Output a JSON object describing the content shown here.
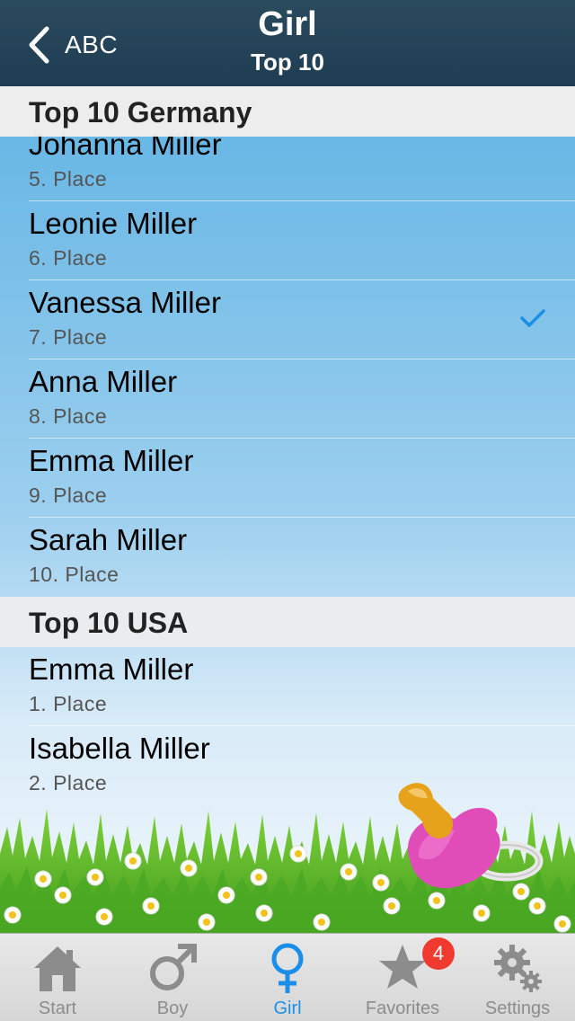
{
  "navbar": {
    "back_label": "ABC",
    "title": "Girl",
    "subtitle": "Top 10"
  },
  "sections": [
    {
      "header": "Top 10 Germany",
      "rows": [
        {
          "name": "Johanna Miller",
          "place": "5. Place",
          "checked": false
        },
        {
          "name": "Leonie Miller",
          "place": "6. Place",
          "checked": false
        },
        {
          "name": "Vanessa Miller",
          "place": "7. Place",
          "checked": true
        },
        {
          "name": "Anna Miller",
          "place": "8. Place",
          "checked": false
        },
        {
          "name": "Emma Miller",
          "place": "9. Place",
          "checked": false
        },
        {
          "name": "Sarah Miller",
          "place": "10. Place",
          "checked": false
        }
      ]
    },
    {
      "header": "Top 10 USA",
      "rows": [
        {
          "name": "Emma Miller",
          "place": "1. Place",
          "checked": false
        },
        {
          "name": "Isabella Miller",
          "place": "2. Place",
          "checked": false
        }
      ]
    }
  ],
  "tabbar": {
    "tabs": [
      {
        "label": "Start",
        "icon": "house-icon",
        "active": false
      },
      {
        "label": "Boy",
        "icon": "male-symbol-icon",
        "active": false
      },
      {
        "label": "Girl",
        "icon": "female-symbol-icon",
        "active": true
      },
      {
        "label": "Favorites",
        "icon": "star-icon",
        "active": false,
        "badge": "4"
      },
      {
        "label": "Settings",
        "icon": "gears-icon",
        "active": false
      }
    ]
  },
  "colors": {
    "navbar": "#1f3d52",
    "accent": "#1a8ee8",
    "badge": "#f03a30",
    "tab_inactive": "#8c8c8c"
  }
}
